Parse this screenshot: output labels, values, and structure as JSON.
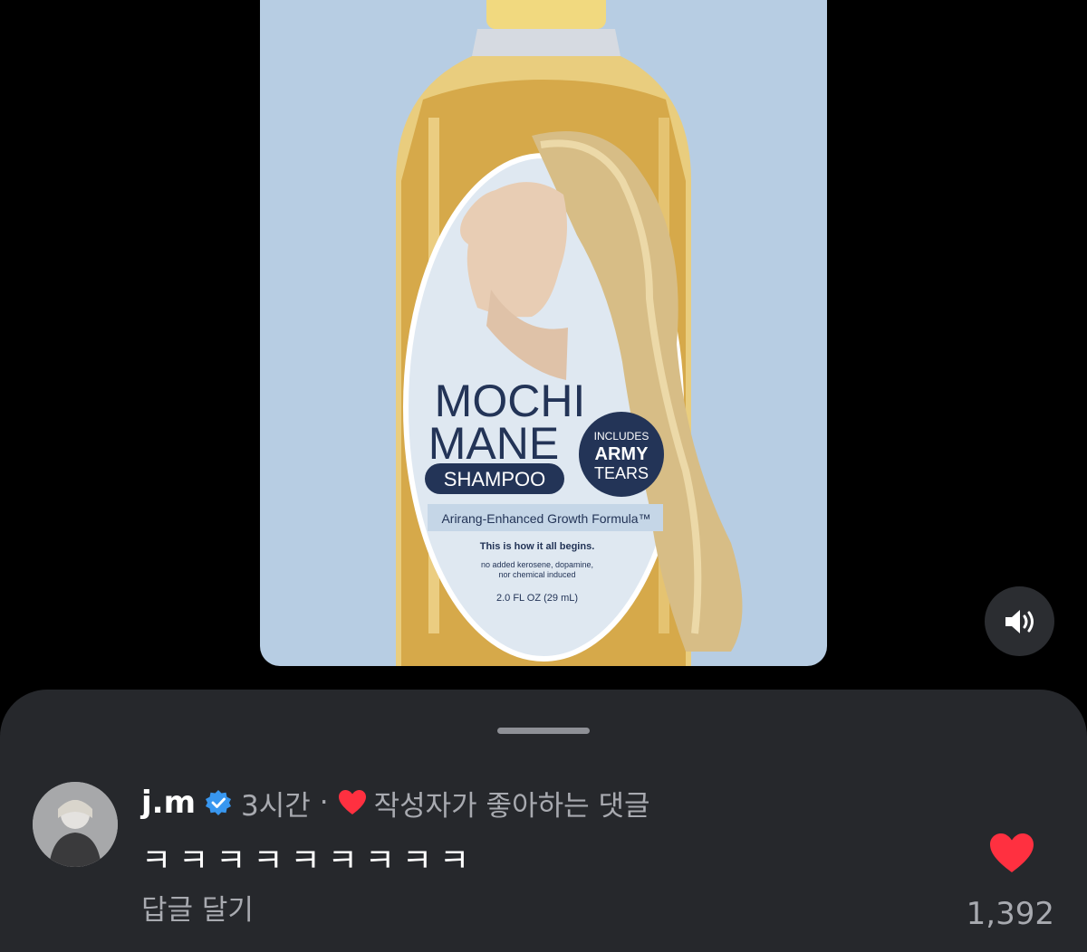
{
  "media": {
    "product_name_line1": "MOCHI",
    "product_name_line2": "MANE",
    "product_type": "SHAMPOO",
    "badge_line1": "INCLUDES",
    "badge_line2": "ARMY",
    "badge_line3": "TEARS",
    "formula": "Arirang-Enhanced Growth Formula™",
    "tagline": "This is how it all begins.",
    "fine_print_line1": "no added kerosene, dopamine,",
    "fine_print_line2": "nor chemical induced",
    "volume": "2.0 FL OZ (29 mL)",
    "colors": {
      "background": "#b7cde3",
      "liquid": "#d6a94a",
      "cap": "#f1d97f",
      "badge": "#233457"
    }
  },
  "sound_button": {
    "icon": "speaker-icon"
  },
  "comment": {
    "username": "j.m",
    "verified_icon": "verified-badge-icon",
    "time": "3시간",
    "separator": "·",
    "liked_by_author_icon": "heart-icon",
    "liked_by_author_text": "작성자가 좋아하는 댓글",
    "text": "ㅋㅋㅋㅋㅋㅋㅋㅋㅋ",
    "reply_label": "답글 달기",
    "like_icon": "heart-icon",
    "like_count": "1,392",
    "colors": {
      "heart": "#ff3040",
      "verified": "#3897f0"
    }
  }
}
